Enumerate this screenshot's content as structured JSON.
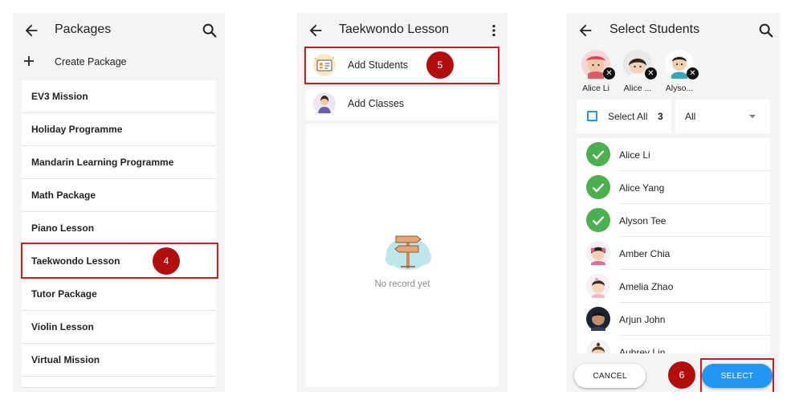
{
  "colors": {
    "panel_bg": "#f4f4f4",
    "highlight_red": "#d11a1a",
    "step_badge": "#b30e0e",
    "primary_blue": "#2196f3",
    "check_green": "#4caf50"
  },
  "packages_screen": {
    "title": "Packages",
    "back_icon": "arrow-left-icon",
    "search_icon": "search-icon",
    "create_label": "Create Package",
    "items": [
      {
        "label": "EV3 Mission"
      },
      {
        "label": "Holiday Programme"
      },
      {
        "label": "Mandarin Learning Programme"
      },
      {
        "label": "Math Package"
      },
      {
        "label": "Piano Lesson"
      },
      {
        "label": "Taekwondo Lesson"
      },
      {
        "label": "Tutor Package"
      },
      {
        "label": "Violin Lesson"
      },
      {
        "label": "Virtual Mission"
      }
    ],
    "step_number": "4"
  },
  "lesson_screen": {
    "title": "Taekwondo Lesson",
    "more_icon": "more-vertical-icon",
    "add_students_label": "Add Students",
    "add_classes_label": "Add Classes",
    "empty_text": "No record yet",
    "step_number": "5"
  },
  "select_screen": {
    "title": "Select Students",
    "selected_chips": [
      {
        "name": "Alice Li"
      },
      {
        "name": "Alice ..."
      },
      {
        "name": "Alyso..."
      }
    ],
    "select_all_label": "Select All",
    "selected_count": "3",
    "filter_value": "All",
    "students": [
      {
        "name": "Alice Li",
        "selected": true
      },
      {
        "name": "Alice Yang",
        "selected": true
      },
      {
        "name": "Alyson Tee",
        "selected": true
      },
      {
        "name": "Amber Chia",
        "selected": false
      },
      {
        "name": "Amelia Zhao",
        "selected": false
      },
      {
        "name": "Arjun John",
        "selected": false
      },
      {
        "name": "Aubrey Lin",
        "selected": false
      }
    ],
    "cancel_label": "CANCEL",
    "select_label": "SELECT",
    "step_number": "6"
  }
}
